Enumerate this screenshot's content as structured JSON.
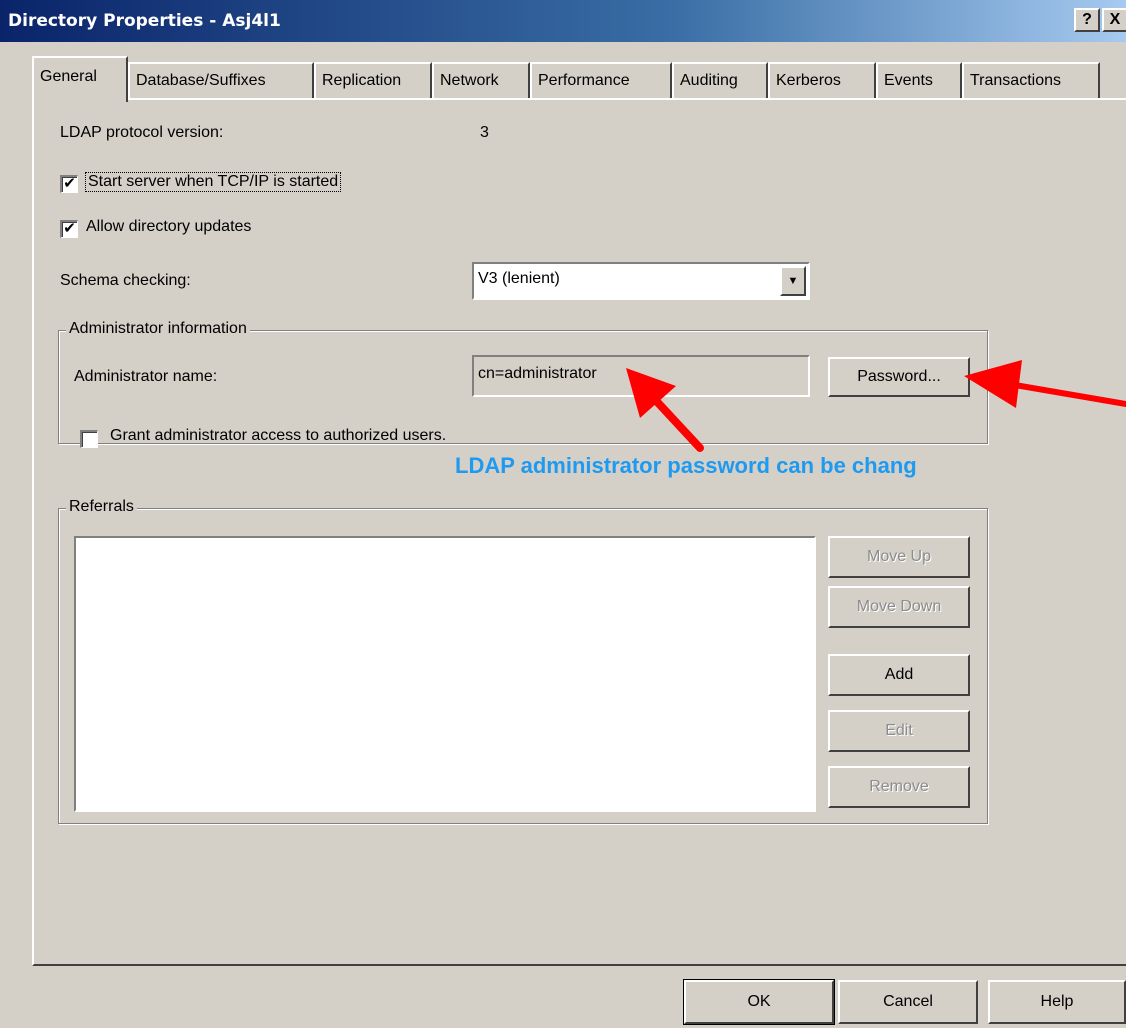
{
  "window": {
    "title": "Directory Properties - Asj4l1",
    "help_button": "?",
    "close_button": "X"
  },
  "tabs": [
    {
      "label": "General",
      "active": true
    },
    {
      "label": "Database/Suffixes"
    },
    {
      "label": "Replication"
    },
    {
      "label": "Network"
    },
    {
      "label": "Performance"
    },
    {
      "label": "Auditing"
    },
    {
      "label": "Kerberos"
    },
    {
      "label": "Events"
    },
    {
      "label": "Transactions"
    }
  ],
  "general": {
    "ldap_version_label": "LDAP protocol version:",
    "ldap_version_value": "3",
    "start_server": {
      "label": "Start server when TCP/IP is started",
      "checked": true
    },
    "allow_updates": {
      "label": "Allow directory updates",
      "checked": true
    },
    "schema_label": "Schema checking:",
    "schema_value": "V3 (lenient)"
  },
  "admin": {
    "group_label": "Administrator information",
    "name_label": "Administrator name:",
    "name_value": "cn=administrator",
    "password_button": "Password...",
    "grant_access": {
      "label": "Grant administrator access to authorized users.",
      "checked": false
    }
  },
  "referrals": {
    "group_label": "Referrals",
    "items": [],
    "move_up": "Move Up",
    "move_down": "Move Down",
    "add": "Add",
    "edit": "Edit",
    "remove": "Remove"
  },
  "footer": {
    "ok": "OK",
    "cancel": "Cancel",
    "help": "Help"
  },
  "annotation": {
    "text": "LDAP administrator password can be chang",
    "text_color": "#1e9af0",
    "arrow_color": "#ff0000"
  },
  "check_glyph": "✔"
}
